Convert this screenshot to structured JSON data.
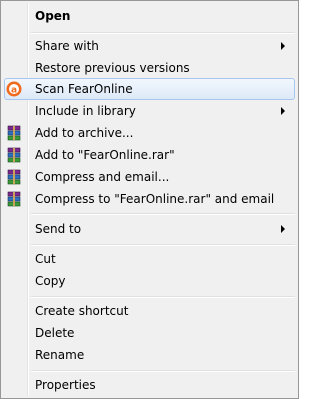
{
  "menu": {
    "items": [
      {
        "label": "Open"
      },
      {
        "label": "Share with"
      },
      {
        "label": "Restore previous versions"
      },
      {
        "label": "Scan FearOnline",
        "icon": "avast-scan-icon"
      },
      {
        "label": "Include in library"
      },
      {
        "label": "Add to archive...",
        "icon": "winrar-archive-icon"
      },
      {
        "label": "Add to \"FearOnline.rar\"",
        "icon": "winrar-archive-icon"
      },
      {
        "label": "Compress and email...",
        "icon": "winrar-archive-icon"
      },
      {
        "label": "Compress to \"FearOnline.rar\" and email",
        "icon": "winrar-archive-icon"
      },
      {
        "label": "Send to"
      },
      {
        "label": "Cut"
      },
      {
        "label": "Copy"
      },
      {
        "label": "Create shortcut"
      },
      {
        "label": "Delete"
      },
      {
        "label": "Rename"
      },
      {
        "label": "Properties"
      }
    ]
  },
  "colors": {
    "menu_background": "#f0f0f0",
    "highlight_border": "#a8c7ee",
    "highlight_fill": "#dde9f7",
    "avast_orange": "#f06a1d"
  }
}
